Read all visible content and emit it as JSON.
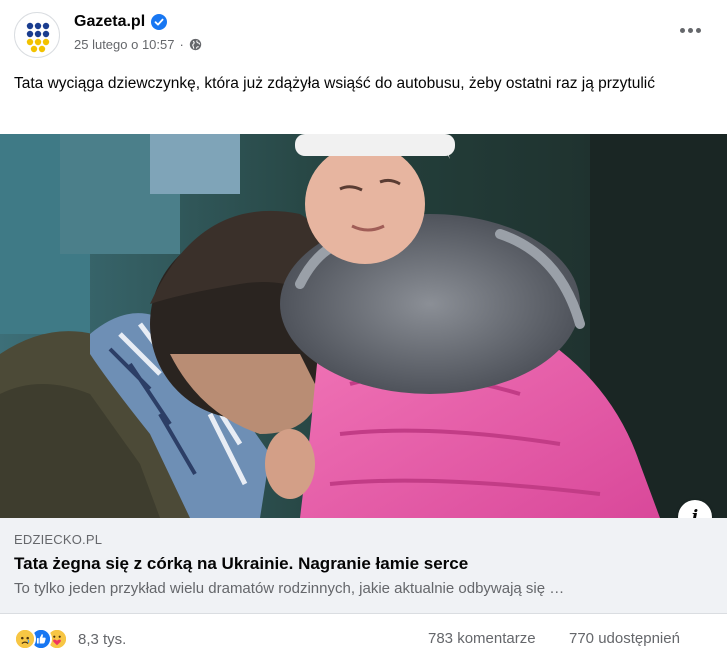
{
  "post": {
    "page_name": "Gazeta.pl",
    "timestamp": "25 lutego o 10:57",
    "separator": "·",
    "text": "Tata wyciąga dziewczynkę, która już zdążyła wsiąść do autobusu, żeby ostatni raz ją przytulić",
    "more_icon": "more-horizontal-icon",
    "privacy_icon": "globe-icon",
    "verified_icon": "verified-badge-icon"
  },
  "link_preview": {
    "domain": "EDZIECKO.PL",
    "title": "Tata żegna się z córką na Ukrainie. Nagranie łamie serce",
    "description": "To tylko jeden przykład wielu dramatów rodzinnych, jakie aktualnie odbywają się …",
    "info_label": "i"
  },
  "footer": {
    "reactions": [
      "sad",
      "like",
      "care"
    ],
    "reaction_count": "8,3 tys.",
    "comments": "783 komentarze",
    "shares": "770 udostępnień"
  },
  "colors": {
    "brand_blue": "#1877f2",
    "secondary_text": "#65676b",
    "link_bg": "#f0f2f5"
  }
}
